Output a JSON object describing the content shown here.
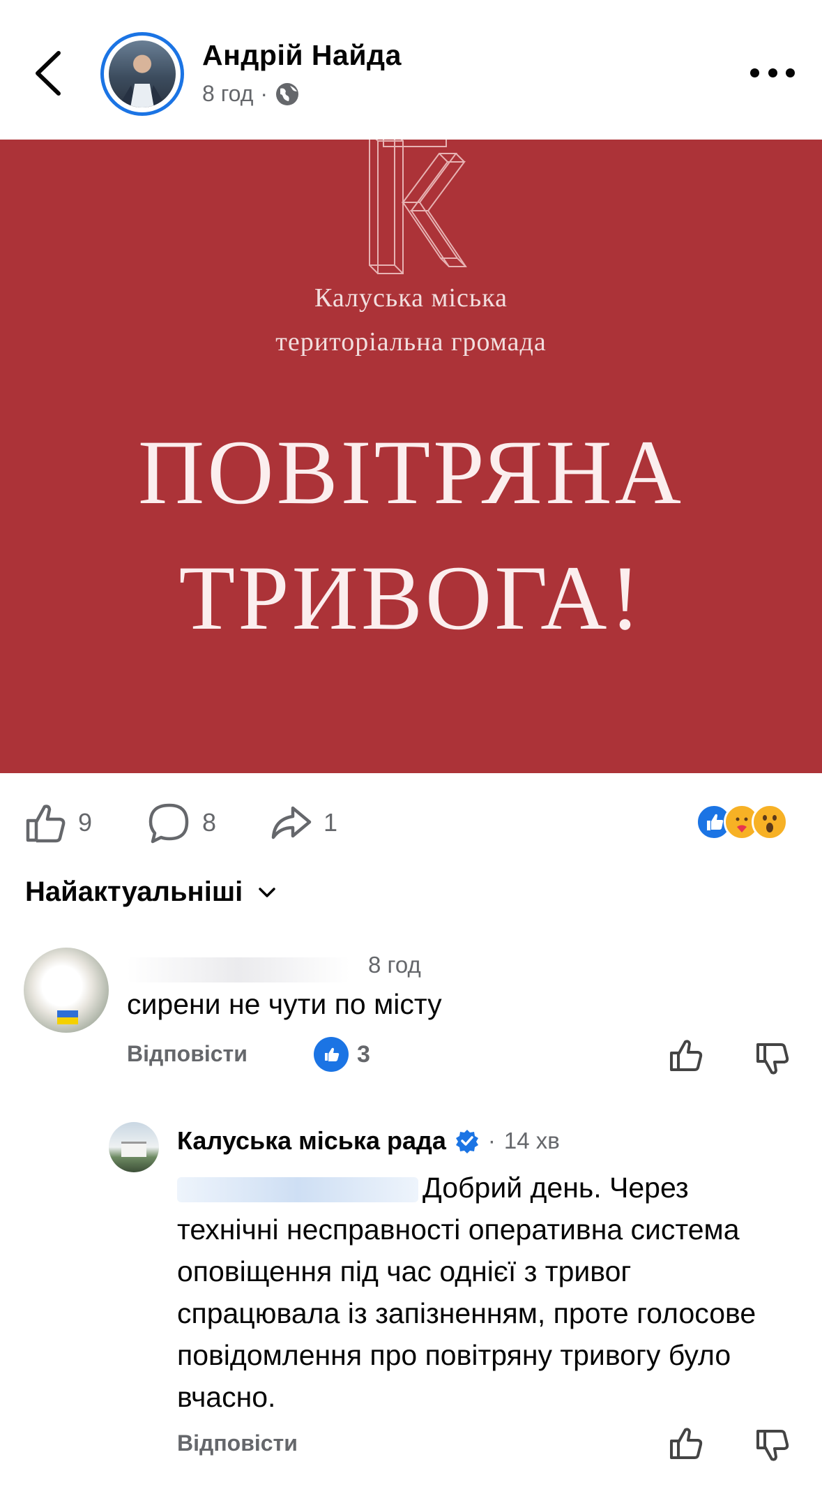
{
  "header": {
    "back_icon": "chevron-left-icon",
    "author_name": "Андрій Найда",
    "post_time": "8 год",
    "separator": "·",
    "audience_icon": "globe-icon",
    "more_icon": "more-horizontal-icon"
  },
  "post_image": {
    "logo_icon": "letter-k-logo",
    "org_line1": "Калуська міська",
    "org_line2": "територіальна громада",
    "alert_line1": "ПОВІТРЯНА",
    "alert_line2": "ТРИВОГА!",
    "background_color": "#ac3338"
  },
  "actions": {
    "like_count": "9",
    "comment_count": "8",
    "share_count": "1",
    "reactions": [
      "like",
      "care",
      "wow"
    ]
  },
  "comments_sort": {
    "label": "Найактуальніші"
  },
  "comment": {
    "author_name_hidden": true,
    "time": "8 год",
    "text": "сирени не чути по місту",
    "reply_label": "Відповісти",
    "like_count": "3"
  },
  "reply": {
    "author_name": "Калуська міська рада",
    "verified": true,
    "separator": "·",
    "time": "14 хв",
    "mention_hidden": true,
    "text": "Добрий день. Через технічні несправності оперативна система оповіщення під час однієї з тривог спрацювала із запізненням, проте голосове повідомлення про повітряну тривогу було вчасно.",
    "reply_label": "Відповісти"
  },
  "colors": {
    "accent_blue": "#1b74e4",
    "secondary_text": "#65676b",
    "primary_text": "#050505",
    "post_red": "#ac3338"
  }
}
